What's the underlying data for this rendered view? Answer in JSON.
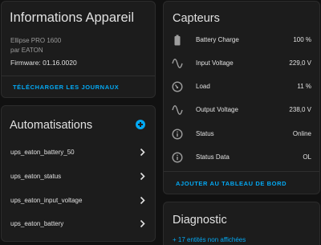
{
  "device_card": {
    "title": "Informations Appareil",
    "model": "Ellipse PRO 1600",
    "manufacturer": "par EATON",
    "firmware": "Firmware: 01.16.0020",
    "download_logs": "TÉLÉCHARGER LES JOURNAUX"
  },
  "automations_card": {
    "title": "Automatisations",
    "add_icon": "plus-circle-icon",
    "items": [
      {
        "label": "ups_eaton_battery_50"
      },
      {
        "label": "ups_eaton_status"
      },
      {
        "label": "ups_eaton_input_voltage"
      },
      {
        "label": "ups_eaton_battery"
      }
    ]
  },
  "sensors_card": {
    "title": "Capteurs",
    "items": [
      {
        "icon": "battery-icon",
        "name": "Battery Charge",
        "value": "100 %"
      },
      {
        "icon": "sine-wave-icon",
        "name": "Input Voltage",
        "value": "229,0 V"
      },
      {
        "icon": "gauge-icon",
        "name": "Load",
        "value": "11 %"
      },
      {
        "icon": "sine-wave-icon",
        "name": "Output Voltage",
        "value": "238,0 V"
      },
      {
        "icon": "info-icon",
        "name": "Status",
        "value": "Online"
      },
      {
        "icon": "info-icon",
        "name": "Status Data",
        "value": "OL"
      }
    ],
    "add_to_dashboard": "AJOUTER AU TABLEAU DE BORD"
  },
  "diagnostic_card": {
    "title": "Diagnostic",
    "hidden_entities": "+ 17 entités non affichées"
  },
  "colors": {
    "accent": "#03a9f4",
    "card_background": "#1c1c1c",
    "page_background": "#111111",
    "icon": "#9e9e9e"
  }
}
